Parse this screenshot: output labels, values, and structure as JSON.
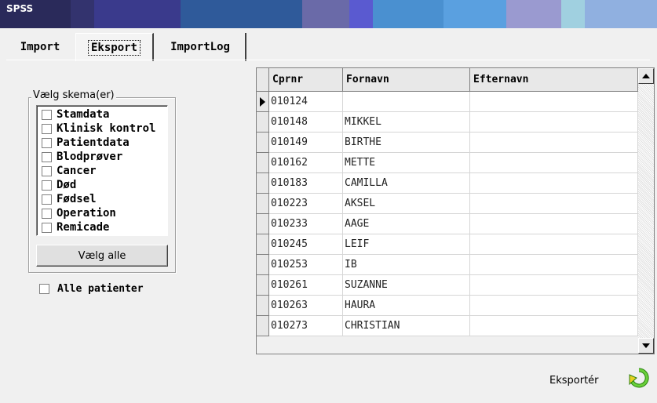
{
  "title": "SPSS",
  "tabs": [
    {
      "label": "Import"
    },
    {
      "label": "Eksport"
    },
    {
      "label": "ImportLog"
    }
  ],
  "schema": {
    "legend": "Vælg skema(er)",
    "items": [
      "Stamdata",
      "Klinisk kontrol",
      "Patientdata",
      "Blodprøver",
      "Cancer",
      "Død",
      "Fødsel",
      "Operation",
      "Remicade"
    ],
    "select_all_label": "Vælg alle"
  },
  "all_patients_label": "Alle patienter",
  "grid": {
    "columns": [
      "Cprnr",
      "Fornavn",
      "Efternavn"
    ],
    "rows": [
      {
        "cpr": "010124",
        "fornavn": "",
        "efternavn": ""
      },
      {
        "cpr": "010148",
        "fornavn": "MIKKEL",
        "efternavn": ""
      },
      {
        "cpr": "010149",
        "fornavn": "BIRTHE",
        "efternavn": ""
      },
      {
        "cpr": "010162",
        "fornavn": "METTE",
        "efternavn": ""
      },
      {
        "cpr": "010183",
        "fornavn": "CAMILLA",
        "efternavn": ""
      },
      {
        "cpr": "010223",
        "fornavn": "AKSEL",
        "efternavn": ""
      },
      {
        "cpr": "010233",
        "fornavn": "AAGE",
        "efternavn": ""
      },
      {
        "cpr": "010245",
        "fornavn": "LEIF",
        "efternavn": ""
      },
      {
        "cpr": "010253",
        "fornavn": "IB",
        "efternavn": ""
      },
      {
        "cpr": "010261",
        "fornavn": "SUZANNE",
        "efternavn": ""
      },
      {
        "cpr": "010263",
        "fornavn": "HAURA",
        "efternavn": ""
      },
      {
        "cpr": "010273",
        "fornavn": "CHRISTIAN",
        "efternavn": ""
      }
    ]
  },
  "export_label": "Eksportér",
  "colors": {
    "titlebar": [
      "#2a2a5a",
      "#3a3a8c",
      "#2f5a9a",
      "#3870b0",
      "#6a6aa8",
      "#5a5ad0",
      "#4a90d0",
      "#5aa0e0",
      "#9a9ad0",
      "#a0d0e0",
      "#90b0e0"
    ],
    "export_icon": "#3aa01a"
  },
  "icons": {
    "row_pointer": "triangle-right-icon",
    "scroll_up": "arrow-up-icon",
    "scroll_down": "arrow-down-icon",
    "export": "export-arrow-icon"
  }
}
